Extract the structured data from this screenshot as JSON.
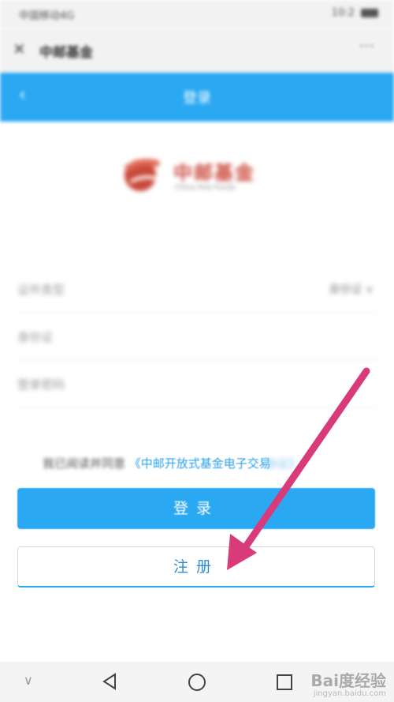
{
  "status_bar": {
    "carrier": "中国移动4G",
    "time": "10:2"
  },
  "app_header": {
    "close_glyph": "✕",
    "title": "中邮基金",
    "more_glyph": "···"
  },
  "nav_header": {
    "back_glyph": "‹",
    "title": "登录"
  },
  "logo": {
    "name": "中邮基金",
    "sub": "China Post Funds"
  },
  "form": {
    "rows": [
      {
        "label": "证件类型",
        "value": "身份证 ∨"
      },
      {
        "label": "身份证",
        "value": ""
      },
      {
        "label": "登录密码",
        "value": ""
      }
    ]
  },
  "agreement": {
    "prefix": "我已阅读并同意",
    "link": "《中邮开放式基金电子交易",
    "suffix": "协议》"
  },
  "buttons": {
    "login": "登录",
    "register": "注册"
  },
  "watermark": {
    "text": "Bai度经验",
    "sub": "jingyan.baidu.com"
  },
  "colors": {
    "accent": "#2aa8f2",
    "arrow": "#d83a7a",
    "logo": "#c9483a"
  },
  "icons": [
    "close-icon",
    "more-icon",
    "back-icon",
    "logo-mark-icon",
    "arrow-annotation",
    "nav-back-icon",
    "nav-home-icon",
    "nav-recent-icon"
  ]
}
